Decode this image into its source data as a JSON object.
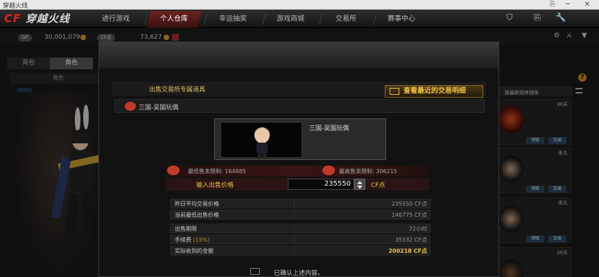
{
  "window": {
    "title": "穿越火线",
    "controls": [
      "⛉",
      "⎘",
      "🔧",
      "─",
      "✕"
    ]
  },
  "logo": {
    "mark": "CF",
    "text": "穿越火线"
  },
  "nav": {
    "tabs": [
      {
        "label": "进行游戏",
        "active": false
      },
      {
        "label": "个人仓库",
        "active": true
      },
      {
        "label": "幸运抽奖",
        "active": false
      },
      {
        "label": "游戏商城",
        "active": false
      },
      {
        "label": "交易所",
        "active": false
      },
      {
        "label": "赛事中心",
        "active": false
      }
    ]
  },
  "currency": {
    "gp_label": "GP",
    "gp_value": "30,001,079",
    "cf_label": "CF点",
    "cf_value": "73,627"
  },
  "left": {
    "tabs": [
      {
        "label": "背包",
        "active": false
      },
      {
        "label": "角色",
        "active": true
      }
    ],
    "char_row": "角色"
  },
  "right": {
    "sort_label": "按最新顺序排序",
    "cards": [
      {
        "tag": "30天",
        "buttons": [
          "领取",
          "交易"
        ]
      },
      {
        "tag": "永久",
        "buttons": [
          "领取",
          "交易"
        ]
      },
      {
        "tag": "永久",
        "buttons": [
          "领取",
          "交易"
        ]
      },
      {
        "tag": "30天"
      }
    ]
  },
  "dialog": {
    "section_title": "出售交易所专属道具",
    "history_button": "查看最近的交易明细",
    "item_name": "三国-吴国玩偶",
    "preview_name": "三国-吴国玩偶",
    "min_limit": "最低售卖限制: 164885",
    "max_limit": "最高售卖限制: 306215",
    "price_label": "输入出售价格",
    "price_value": "235550",
    "price_unit": "CF点",
    "stats": [
      {
        "label": "昨日平均交易价格",
        "value": "235550 CF点"
      },
      {
        "label": "当前最低出售价格",
        "value": "146775 CF点"
      }
    ],
    "details": [
      {
        "label": "出售期限",
        "value": "72小时"
      },
      {
        "label": "手续费",
        "hint": "(15%)",
        "value": "35332 CF点"
      },
      {
        "label": "实际收到的金额",
        "value": "200218 CF点"
      }
    ],
    "confirm_text": "已确认上述内容。"
  }
}
